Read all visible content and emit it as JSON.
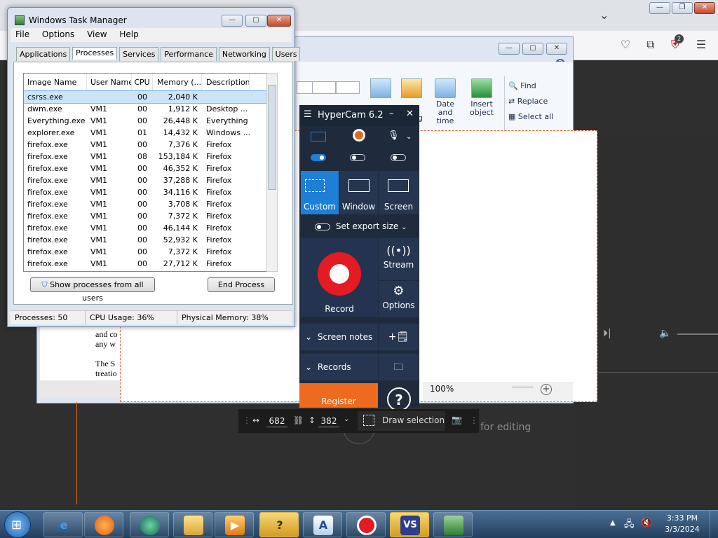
{
  "browser": {
    "extension_badge": "2"
  },
  "wordpad": {
    "ribbon": {
      "buttons": [
        "Date and\ntime",
        "Insert\nobject"
      ],
      "find": "Find",
      "replace": "Replace",
      "select_all": "Select all",
      "partial_label": "ng"
    },
    "doc_text_1": "and co",
    "doc_text_2": "any w",
    "doc_text_3": "The S",
    "doc_text_4": "treatio"
  },
  "media": {
    "edit_hint": "for editing",
    "zoom": "100%"
  },
  "task_manager": {
    "title": "Windows Task Manager",
    "menu": [
      "File",
      "Options",
      "View",
      "Help"
    ],
    "tabs": [
      "Applications",
      "Processes",
      "Services",
      "Performance",
      "Networking",
      "Users"
    ],
    "active_tab": "Processes",
    "columns": [
      "Image Name",
      "User Name",
      "CPU",
      "Memory (...",
      "Description"
    ],
    "rows": [
      [
        "csrss.exe",
        "",
        "00",
        "2,040 K",
        ""
      ],
      [
        "dwm.exe",
        "VM1",
        "00",
        "1,912 K",
        "Desktop ..."
      ],
      [
        "Everything.exe",
        "VM1",
        "00",
        "26,448 K",
        "Everything"
      ],
      [
        "explorer.exe",
        "VM1",
        "01",
        "14,432 K",
        "Windows ..."
      ],
      [
        "firefox.exe",
        "VM1",
        "00",
        "7,376 K",
        "Firefox"
      ],
      [
        "firefox.exe",
        "VM1",
        "08",
        "153,184 K",
        "Firefox"
      ],
      [
        "firefox.exe",
        "VM1",
        "00",
        "46,352 K",
        "Firefox"
      ],
      [
        "firefox.exe",
        "VM1",
        "00",
        "37,288 K",
        "Firefox"
      ],
      [
        "firefox.exe",
        "VM1",
        "00",
        "34,116 K",
        "Firefox"
      ],
      [
        "firefox.exe",
        "VM1",
        "00",
        "3,708 K",
        "Firefox"
      ],
      [
        "firefox.exe",
        "VM1",
        "00",
        "7,372 K",
        "Firefox"
      ],
      [
        "firefox.exe",
        "VM1",
        "00",
        "46,144 K",
        "Firefox"
      ],
      [
        "firefox.exe",
        "VM1",
        "00",
        "52,932 K",
        "Firefox"
      ],
      [
        "firefox.exe",
        "VM1",
        "00",
        "7,372 K",
        "Firefox"
      ],
      [
        "firefox.exe",
        "VM1",
        "00",
        "27,712 K",
        "Firefox"
      ]
    ],
    "show_all_button": "Show processes from all users",
    "end_process_button": "End Process",
    "status": {
      "processes": "Processes: 50",
      "cpu": "CPU Usage: 36%",
      "memory": "Physical Memory: 38%"
    }
  },
  "hypercam": {
    "title": "HyperCam 6.2",
    "modes": [
      "Custom",
      "Window",
      "Screen"
    ],
    "active_mode": "Custom",
    "export_size": "Set export size",
    "record": "Record",
    "stream": "Stream",
    "options": "Options",
    "screen_notes": "Screen notes",
    "records": "Records",
    "register": "Register",
    "help": "?"
  },
  "selection_toolbar": {
    "width": "682",
    "height": "382",
    "draw_selection": "Draw selection"
  },
  "taskbar": {
    "time": "3:33 PM",
    "date": "3/3/2024"
  },
  "colors": {
    "hypercam_bg": "#1f2b3d",
    "hypercam_accent": "#1e7fd6",
    "record_red": "#e31b23",
    "register_orange": "#ee6a1e",
    "selection_border": "#e06a3b"
  }
}
